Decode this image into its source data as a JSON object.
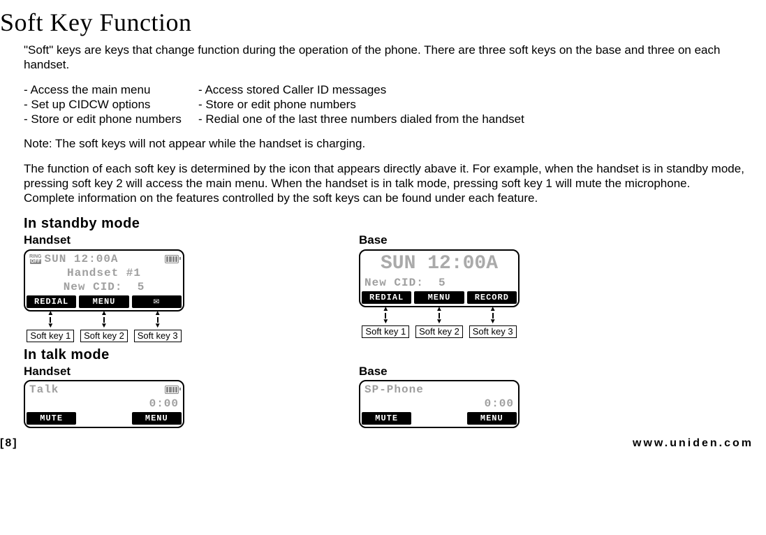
{
  "title": "Soft Key Function",
  "intro": "\"Soft\" keys are keys that change function during the operation of the phone. There are three soft keys on the base and three on each handset.",
  "list": {
    "rows": [
      {
        "a": "- Access the main menu",
        "b": "- Access stored Caller ID messages"
      },
      {
        "a": "- Set up CIDCW options",
        "b": "- Store or edit phone numbers"
      },
      {
        "a": "- Store or edit phone numbers",
        "b": "- Redial one of the last three numbers dialed from the handset"
      }
    ]
  },
  "note": "Note: The soft keys will not appear while the handset is charging.",
  "para": "The function of each soft key is determined by the icon that appears directly abave it. For example, when the handset is in standby mode, pressing soft key 2 will access the main menu. When the handset is in talk mode, pressing soft key 1 will mute the microphone.\nComplete information on the features controlled by the soft keys can be found under each feature.",
  "standby": {
    "heading": "In standby mode",
    "handset_label": "Handset",
    "base_label": "Base",
    "handset_screen": {
      "line1": "SUN 12:00A",
      "line2": "Handset #1",
      "line3": "New CID:  5",
      "soft": [
        "REDIAL",
        "MENU",
        ""
      ]
    },
    "base_screen": {
      "big": "SUN 12:00A",
      "line2": "New CID:  5",
      "soft": [
        "REDIAL",
        "MENU",
        "RECORD"
      ]
    },
    "key_labels": [
      "Soft key 1",
      "Soft key 2",
      "Soft key 3"
    ]
  },
  "talk": {
    "heading": "In talk mode",
    "handset_label": "Handset",
    "base_label": "Base",
    "handset_screen": {
      "line1": "Talk",
      "line2": "0:00",
      "soft": [
        "MUTE",
        "",
        "MENU"
      ]
    },
    "base_screen": {
      "line1": "SP-Phone",
      "line2": "0:00",
      "soft": [
        "MUTE",
        "",
        "MENU"
      ]
    }
  },
  "footer": {
    "left": "[8]",
    "right": "www.uniden.com"
  }
}
